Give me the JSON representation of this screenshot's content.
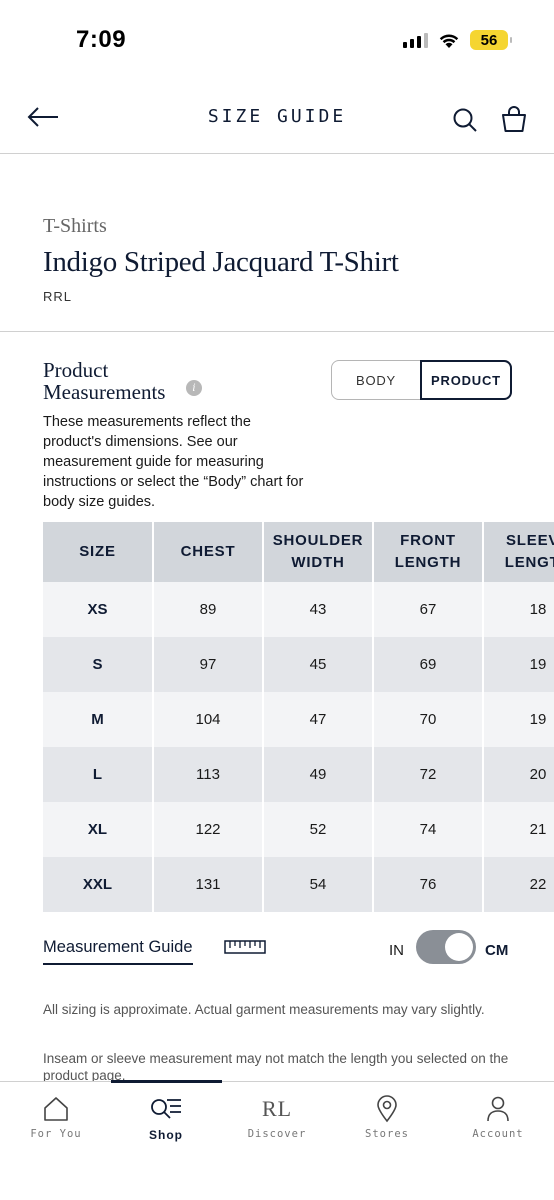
{
  "status_bar": {
    "time": "7:09",
    "battery": "56"
  },
  "header": {
    "title": "SIZE GUIDE"
  },
  "product": {
    "category": "T-Shirts",
    "name": "Indigo Striped Jacquard T-Shirt",
    "brand": "RRL"
  },
  "measurements": {
    "title_line1": "Product",
    "title_line2": "Measurements",
    "description": "These measurements reflect the product's dimensions. See our measurement guide for measuring instructions or select the “Body” chart for body size guides.",
    "toggle_body": "BODY",
    "toggle_product": "PRODUCT",
    "selected_toggle": "PRODUCT"
  },
  "table": {
    "headers": [
      [
        "SIZE"
      ],
      [
        "CHEST"
      ],
      [
        "SHOULDER",
        "WIDTH"
      ],
      [
        "FRONT",
        "LENGTH"
      ],
      [
        "SLEEVE",
        "LENGTH"
      ]
    ],
    "rows": [
      [
        "XS",
        "89",
        "43",
        "67",
        "18"
      ],
      [
        "S",
        "97",
        "45",
        "69",
        "19"
      ],
      [
        "M",
        "104",
        "47",
        "70",
        "19"
      ],
      [
        "L",
        "113",
        "49",
        "72",
        "20"
      ],
      [
        "XL",
        "122",
        "52",
        "74",
        "21"
      ],
      [
        "XXL",
        "131",
        "54",
        "76",
        "22"
      ]
    ]
  },
  "guide": {
    "link_label": "Measurement Guide",
    "unit_in": "IN",
    "unit_cm": "CM",
    "selected_unit": "CM"
  },
  "notes": {
    "note1": "All sizing is approximate. Actual garment measurements may vary slightly.",
    "note2": "Inseam or sleeve measurement may not match the length you selected on the product page."
  },
  "nav": {
    "items": [
      {
        "label": "For You",
        "icon": "home-icon"
      },
      {
        "label": "Shop",
        "icon": "shop-search-icon"
      },
      {
        "label": "Discover",
        "icon": "rl-logo"
      },
      {
        "label": "Stores",
        "icon": "location-pin-icon"
      },
      {
        "label": "Account",
        "icon": "person-icon"
      }
    ],
    "active": "Shop",
    "logo_text": "RL"
  },
  "colors": {
    "navy": "#0f1b33",
    "battery": "#f5d531",
    "table_header": "#d2d6db",
    "row_light": "#f3f4f6",
    "row_dark": "#e4e6ea"
  }
}
